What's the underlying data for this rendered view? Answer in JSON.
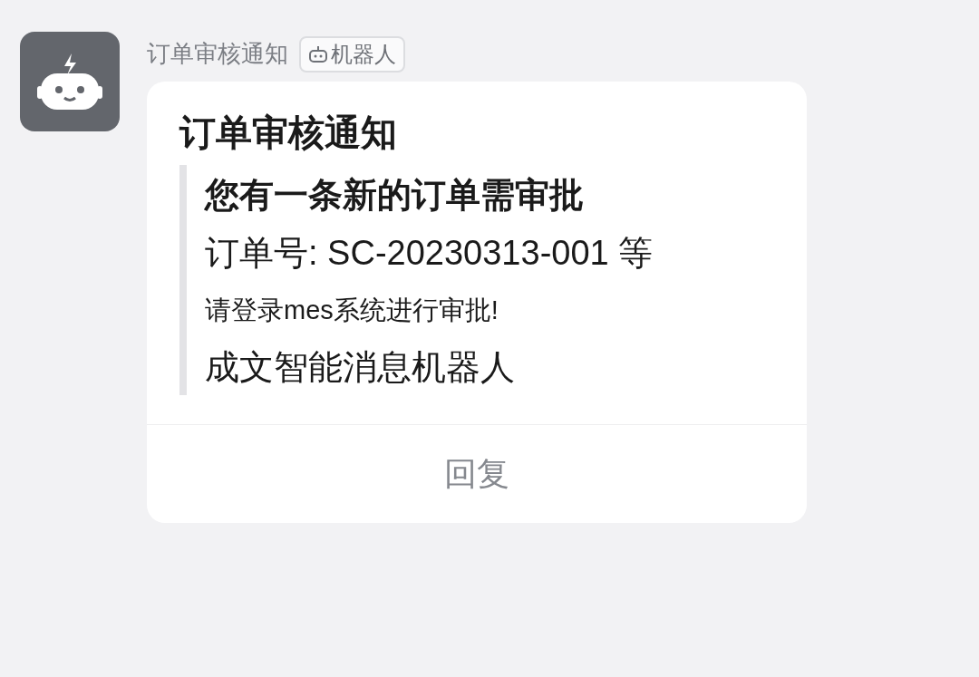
{
  "sender": {
    "name": "订单审核通知",
    "badge": "机器人"
  },
  "card": {
    "title": "订单审核通知",
    "lines": [
      {
        "kind": "heading",
        "text": "您有一条新的订单需审批"
      },
      {
        "kind": "large",
        "text": "订单号: SC-20230313-001 等"
      },
      {
        "kind": "small",
        "text": "请登录mes系统进行审批!"
      },
      {
        "kind": "large",
        "text": "成文智能消息机器人"
      }
    ],
    "action": "回复"
  }
}
